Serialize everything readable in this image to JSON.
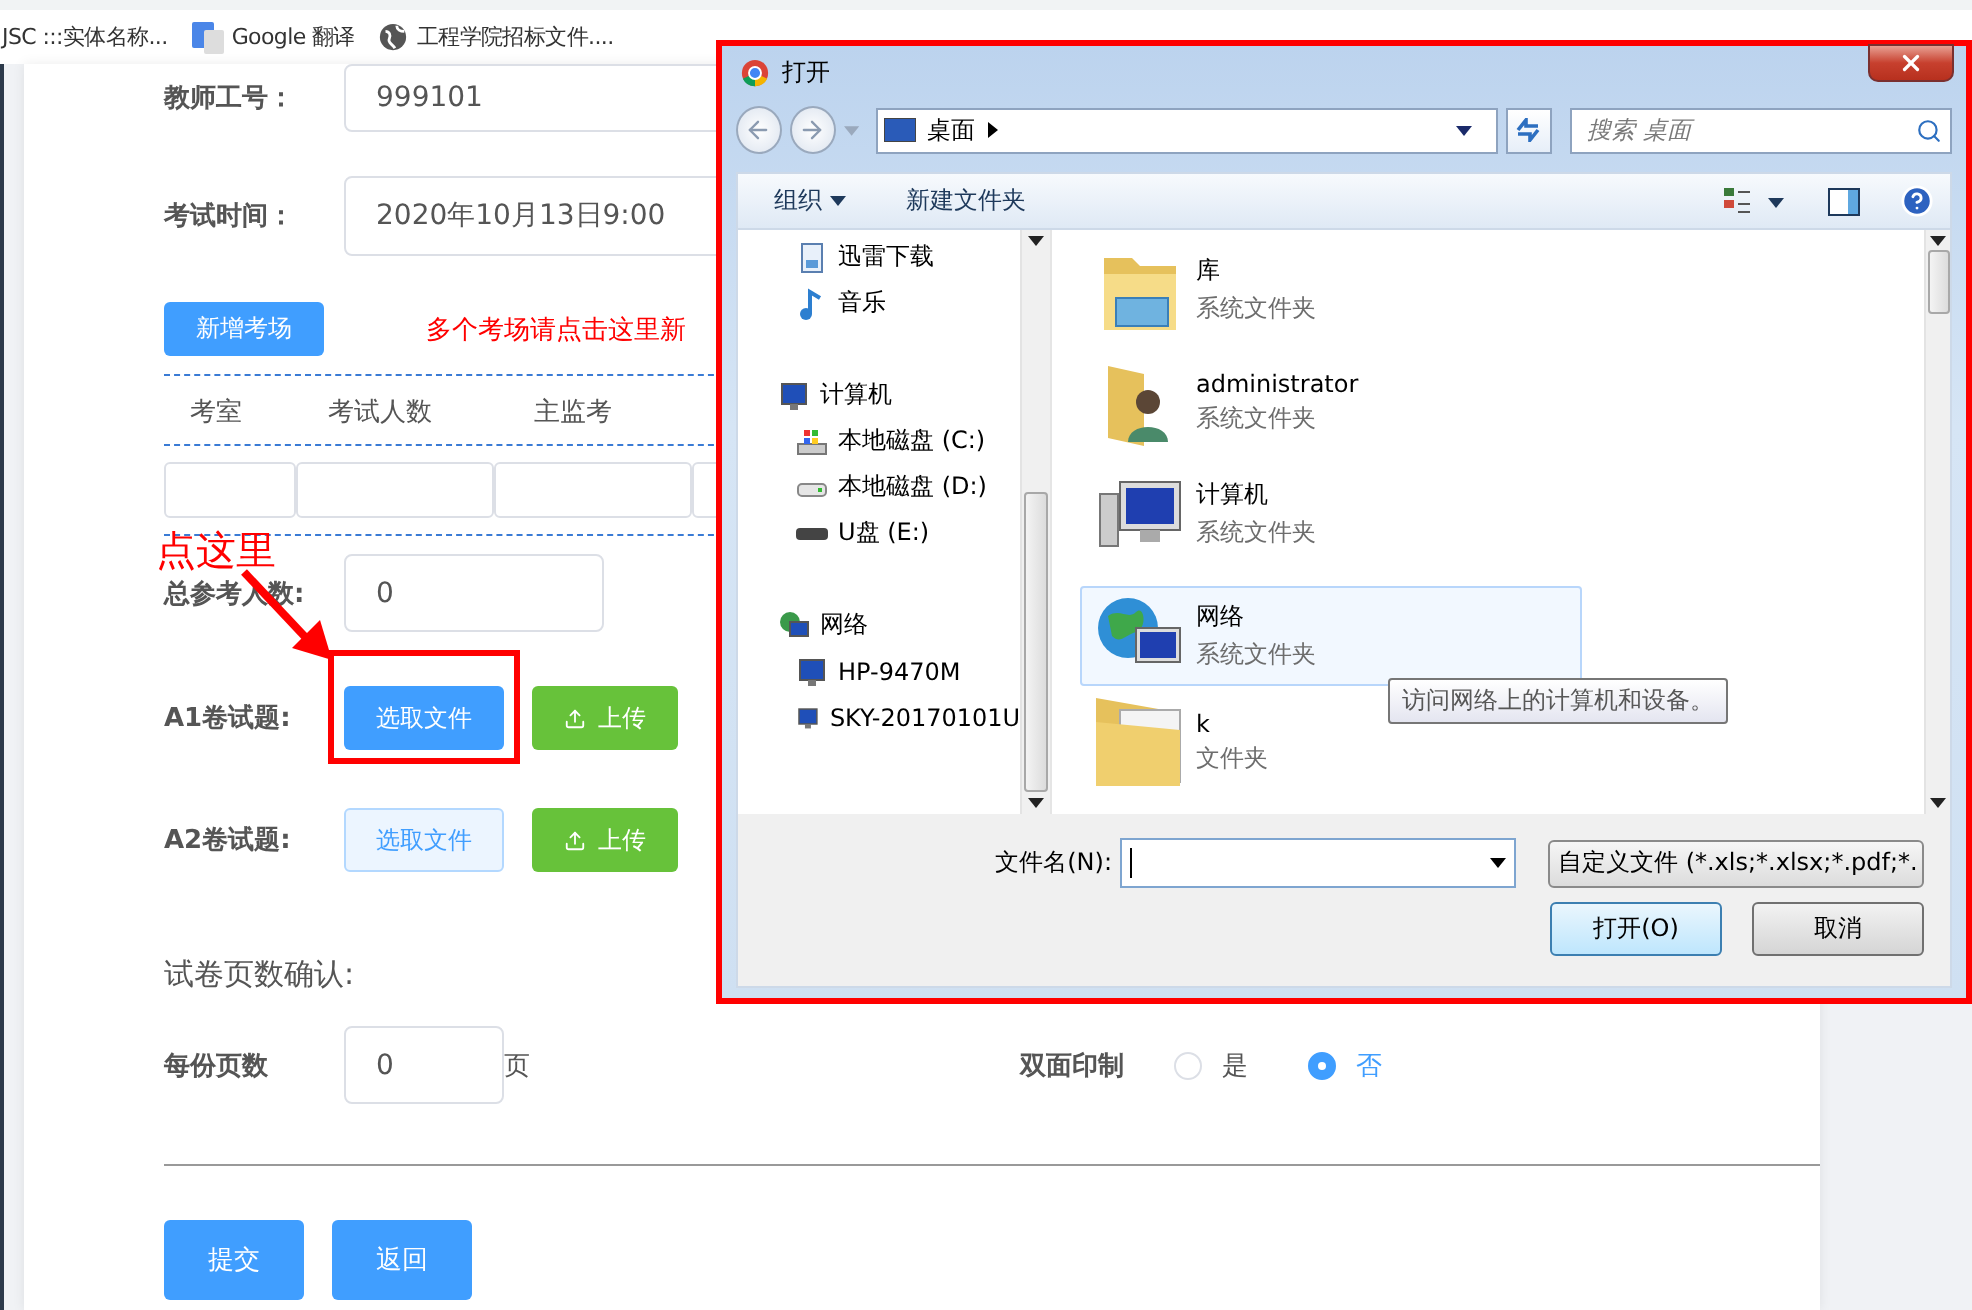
{
  "bookmarks": [
    {
      "label": "JSC :::实体名称...",
      "kind": "none"
    },
    {
      "label": "Google 翻译",
      "kind": "translate"
    },
    {
      "label": "工程学院招标文件....",
      "kind": "globe"
    }
  ],
  "form": {
    "teacher_id": {
      "label": "教师工号：",
      "value": "999101"
    },
    "exam_time": {
      "label": "考试时间：",
      "value": "2020年10月13日9:00"
    },
    "add_room": {
      "button": "新增考场",
      "hint": "多个考场请点击这里新"
    },
    "room_table": {
      "columns": [
        "考室",
        "考试人数",
        "主监考"
      ]
    },
    "total": {
      "label": "总参考人数:",
      "value": "0"
    },
    "papers": [
      {
        "label": "A1卷试题:",
        "choose": "选取文件",
        "upload": "上传",
        "primary": true
      },
      {
        "label": "A2卷试题:",
        "choose": "选取文件",
        "upload": "上传",
        "primary": false
      }
    ],
    "section_title": "试卷页数确认:",
    "pages": {
      "label": "每份页数",
      "value": "0",
      "unit": "页"
    },
    "duplex": {
      "label": "双面印制",
      "options": [
        {
          "label": "是",
          "selected": false
        },
        {
          "label": "否",
          "selected": true
        }
      ]
    },
    "buttons": [
      "提交",
      "返回"
    ]
  },
  "annotation": {
    "text": "点这里"
  },
  "dialog": {
    "title": "打开",
    "address": "桌面",
    "search": {
      "placeholder": "搜索 桌面"
    },
    "toolbar": {
      "organize": "组织",
      "new_folder": "新建文件夹"
    },
    "nav_tree": [
      {
        "children": [
          {
            "label": "迅雷下载",
            "kind": "download"
          },
          {
            "label": "音乐",
            "kind": "music"
          }
        ]
      },
      {
        "label": "计算机",
        "kind": "computer",
        "children": [
          {
            "label": "本地磁盘 (C:)",
            "kind": "windrive"
          },
          {
            "label": "本地磁盘 (D:)",
            "kind": "drive"
          },
          {
            "label": "U盘 (E:)",
            "kind": "usb"
          }
        ]
      },
      {
        "label": "网络",
        "kind": "network",
        "children": [
          {
            "label": "HP-9470M",
            "kind": "pc"
          },
          {
            "label": "SKY-20170101U",
            "kind": "pc"
          }
        ]
      }
    ],
    "files": [
      {
        "name": "库",
        "type": "系统文件夹",
        "kind": "library",
        "selected": false
      },
      {
        "name": "administrator",
        "type": "系统文件夹",
        "kind": "user",
        "selected": false
      },
      {
        "name": "计算机",
        "type": "系统文件夹",
        "kind": "computer",
        "selected": false
      },
      {
        "name": "网络",
        "type": "系统文件夹",
        "kind": "network",
        "selected": true
      },
      {
        "name": "k",
        "type": "文件夹",
        "kind": "folder",
        "selected": false
      }
    ],
    "tooltip": "访问网络上的计算机和设备。",
    "file_name": {
      "label": "文件名(N):"
    },
    "filter": "自定义文件 (*.xls;*.xlsx;*.pdf;*.",
    "buttons": [
      {
        "label": "打开(O)",
        "default": true
      },
      {
        "label": "取消",
        "default": false
      }
    ]
  }
}
